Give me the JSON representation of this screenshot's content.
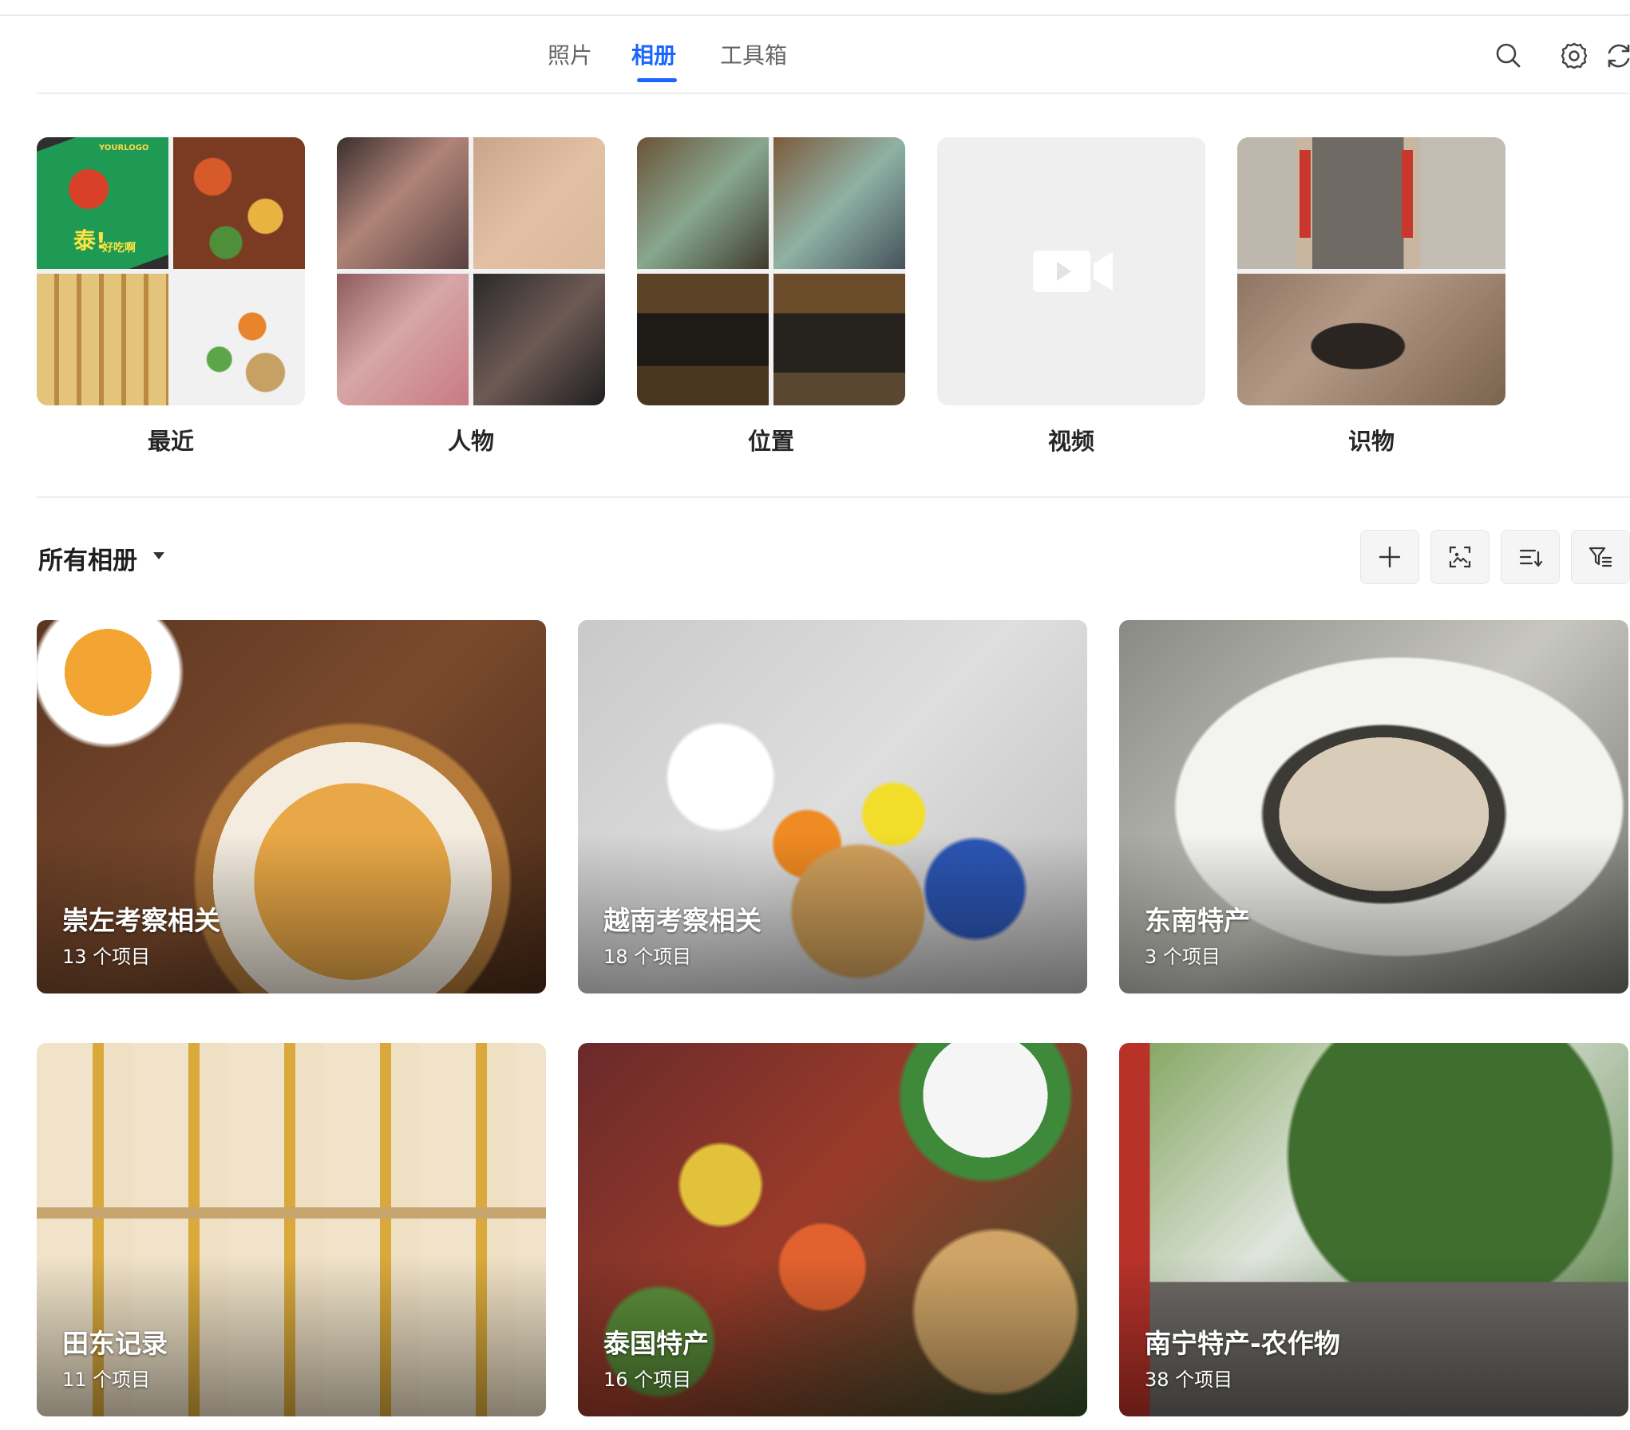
{
  "tabs": [
    {
      "label": "照片"
    },
    {
      "label": "相册"
    },
    {
      "label": "工具箱"
    }
  ],
  "active_tab": "相册",
  "toolbar_icons": [
    "search-icon",
    "settings-icon",
    "refresh-icon"
  ],
  "categories": [
    {
      "label": "最近"
    },
    {
      "label": "人物"
    },
    {
      "label": "位置"
    },
    {
      "label": "视频"
    },
    {
      "label": "识物"
    }
  ],
  "recent_thumb_text": {
    "logo": "YOURLOGO",
    "headline": "泰!",
    "sub": "好吃啊"
  },
  "albums_section": {
    "title": "所有相册",
    "tool_icons": [
      "add-icon",
      "image-search-icon",
      "sort-icon",
      "filter-icon"
    ]
  },
  "albums": [
    {
      "title": "崇左考察相关",
      "count": "13 个项目"
    },
    {
      "title": "越南考察相关",
      "count": "18 个项目"
    },
    {
      "title": "东南特产",
      "count": "3 个项目"
    },
    {
      "title": "田东记录",
      "count": "11 个项目"
    },
    {
      "title": "泰国特产",
      "count": "16 个项目"
    },
    {
      "title": "南宁特产-农作物",
      "count": "38 个项目"
    }
  ],
  "colors": {
    "accent": "#1a66ff",
    "tab_inactive": "#666666"
  }
}
